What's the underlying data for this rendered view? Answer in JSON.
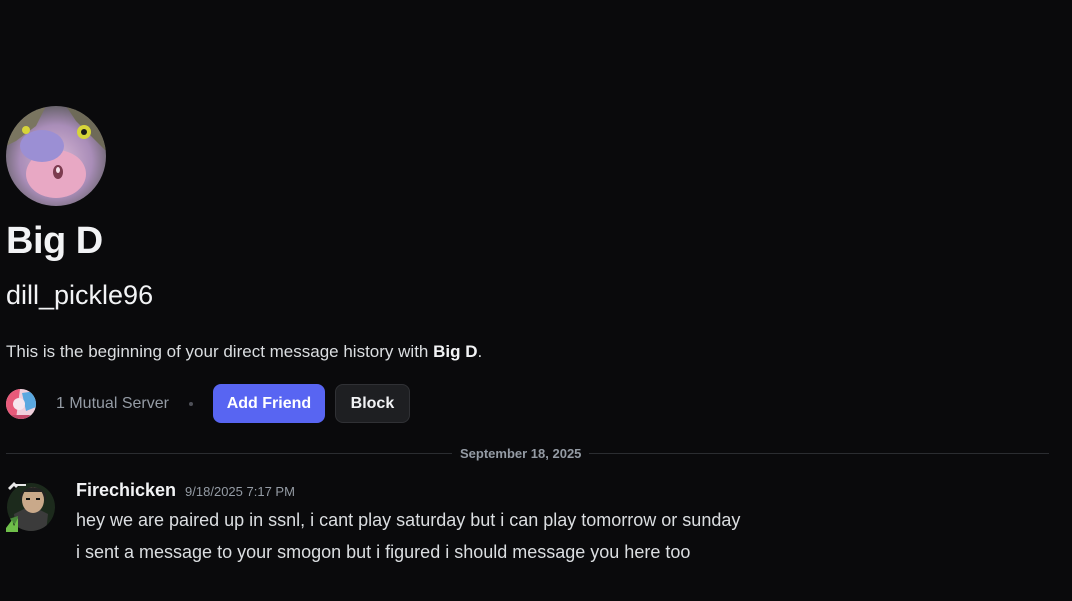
{
  "profile": {
    "display_name": "Big D",
    "username": "dill_pickle96",
    "intro_prefix": "This is the beginning of your direct message history with ",
    "intro_name": "Big D",
    "intro_suffix": "."
  },
  "actions": {
    "mutual_servers": "1 Mutual Server",
    "add_friend": "Add Friend",
    "block": "Block"
  },
  "divider": {
    "date": "September 18, 2025"
  },
  "message": {
    "author": "Firechicken",
    "timestamp": "9/18/2025 7:17 PM",
    "lines": [
      "hey we are paired up in ssnl, i cant play saturday but i can play tomorrow or sunday",
      "i sent a message to your smogon but i figured i should message you here too"
    ]
  },
  "colors": {
    "background": "#0a0a0c",
    "accent": "#5865f2",
    "muted_text": "#949ba4"
  },
  "icons": {
    "profile_avatar": "user-avatar-icon",
    "mutual_server": "server-icon",
    "message_avatar": "user-avatar-icon"
  }
}
